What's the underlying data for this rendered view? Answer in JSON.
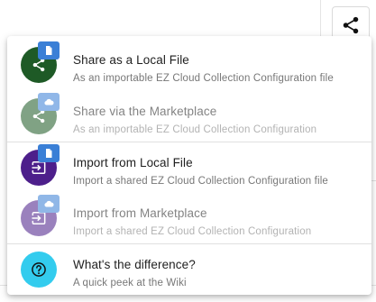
{
  "colors": {
    "green": "#1e5a26",
    "purple": "#4d1f8b",
    "cyan": "#33ccee",
    "badge_blue": "#3a7fd6",
    "title_text": "#1f1f1f",
    "subtitle_text": "#777777"
  },
  "toolbar": {
    "share_icon": "share-icon"
  },
  "menu": {
    "share": [
      {
        "title": "Share as a Local File",
        "subtitle": "As an importable EZ Cloud Collection Configuration file",
        "icon": "share-icon",
        "badge_icon": "file-icon",
        "enabled": true
      },
      {
        "title": "Share via the Marketplace",
        "subtitle": "As an importable EZ Cloud Collection Configuration",
        "icon": "share-icon",
        "badge_icon": "cloud-icon",
        "enabled": false
      }
    ],
    "import": [
      {
        "title": "Import from Local File",
        "subtitle": "Import a shared EZ Cloud Collection Configuration file",
        "icon": "import-icon",
        "badge_icon": "file-icon",
        "enabled": true
      },
      {
        "title": "Import from Marketplace",
        "subtitle": "Import a shared EZ Cloud Collection Configuration",
        "icon": "import-icon",
        "badge_icon": "cloud-icon",
        "enabled": false
      }
    ],
    "help": {
      "title": "What's the difference?",
      "subtitle": "A quick peek at the Wiki",
      "icon": "question-circle-icon",
      "enabled": true
    }
  }
}
